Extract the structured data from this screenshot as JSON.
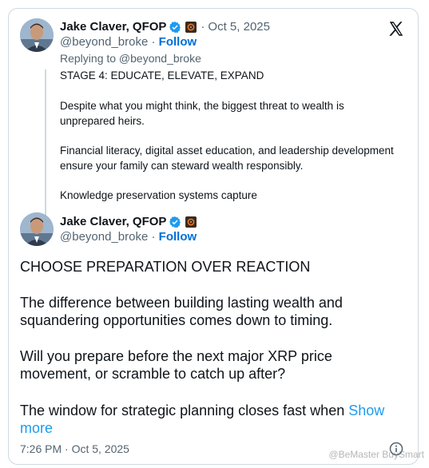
{
  "tweet1": {
    "name": "Jake Claver, QFOP",
    "separator": "·",
    "date": "Oct 5, 2025",
    "handle": "@beyond_broke",
    "handle_sep": "·",
    "follow": "Follow",
    "replying_to": "Replying to @beyond_broke",
    "lines": [
      "STAGE 4: EDUCATE, ELEVATE, EXPAND",
      "Despite what you might think, the biggest threat to wealth is",
      "unprepared heirs.",
      "Financial literacy, digital asset education, and leadership development",
      "ensure your family can steward wealth responsibly.",
      "Knowledge preservation systems capture"
    ]
  },
  "tweet2": {
    "name": "Jake Claver, QFOP",
    "handle": "@beyond_broke",
    "handle_sep": "·",
    "follow": "Follow",
    "lines": [
      "CHOOSE PREPARATION OVER REACTION",
      "The difference between building lasting wealth and",
      "squandering opportunities comes down to timing.",
      "Will you prepare before the next major XRP price",
      "movement, or scramble to catch up after?",
      "The window for strategic planning closes fast when"
    ],
    "show_more_a": "Show",
    "show_more_b": "more",
    "timestamp": "7:26 PM · Oct 5, 2025"
  },
  "watermark": "@BeMaster BuySmart",
  "icons": [
    "verified-badge-icon",
    "affiliate-badge-icon",
    "x-logo-icon",
    "info-icon"
  ],
  "colors": {
    "link": "#006fd6",
    "show_more": "#1d9bf0",
    "verified": "#1d9bf0",
    "secondary": "#536471"
  }
}
